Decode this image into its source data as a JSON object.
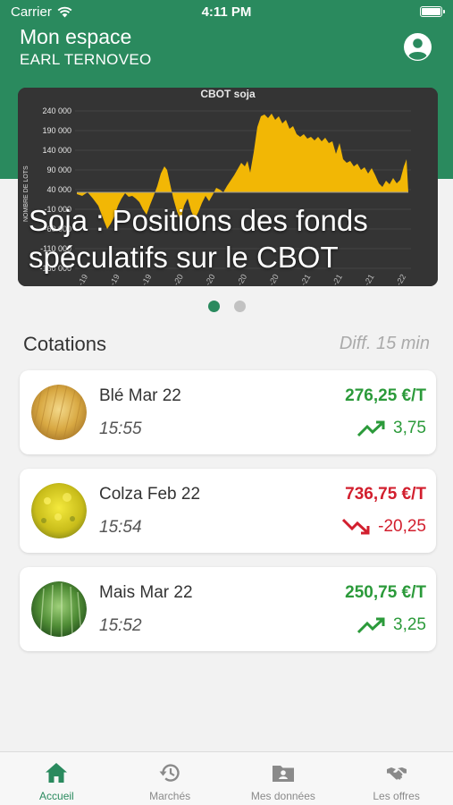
{
  "status_bar": {
    "carrier": "Carrier",
    "time": "4:11 PM"
  },
  "header": {
    "title": "Mon espace",
    "subtitle": "EARL TERNOVEO"
  },
  "carousel": {
    "title": "Soja : Positions des fonds spéculatifs sur le CBOT",
    "chart_title": "CBOT soja",
    "y_axis_label": "NOMBRE DE LOTS",
    "y_ticks": [
      "240 000",
      "190 000",
      "140 000",
      "90 000",
      "40 000",
      "-10 000",
      "-60 000",
      "-110 000",
      "-160 000"
    ],
    "x_ticks": [
      "-19",
      "-19",
      "-19",
      "-20",
      "-20",
      "-20",
      "-20",
      "-21",
      "-21",
      "-21",
      "-22"
    ],
    "page_count": 2,
    "active_page": 1
  },
  "quotes_section": {
    "title": "Cotations",
    "note": "Diff. 15 min"
  },
  "quotes": [
    {
      "name": "Blé Mar 22",
      "time": "15:55",
      "price": "276,25 €/T",
      "change": "3,75",
      "direction": "up"
    },
    {
      "name": "Colza Feb 22",
      "time": "15:54",
      "price": "736,75 €/T",
      "change": "-20,25",
      "direction": "down"
    },
    {
      "name": "Mais Mar 22",
      "time": "15:52",
      "price": "250,75 €/T",
      "change": "3,25",
      "direction": "up"
    }
  ],
  "tabs": [
    {
      "label": "Accueil",
      "icon": "home-icon",
      "active": true
    },
    {
      "label": "Marchés",
      "icon": "history-icon",
      "active": false
    },
    {
      "label": "Mes données",
      "icon": "folder-user-icon",
      "active": false
    },
    {
      "label": "Les offres",
      "icon": "handshake-icon",
      "active": false
    }
  ],
  "colors": {
    "brand_green": "#2a8a5e",
    "up_green": "#2b9a3a",
    "down_red": "#d21f2e",
    "chart_fill": "#f2b705"
  }
}
